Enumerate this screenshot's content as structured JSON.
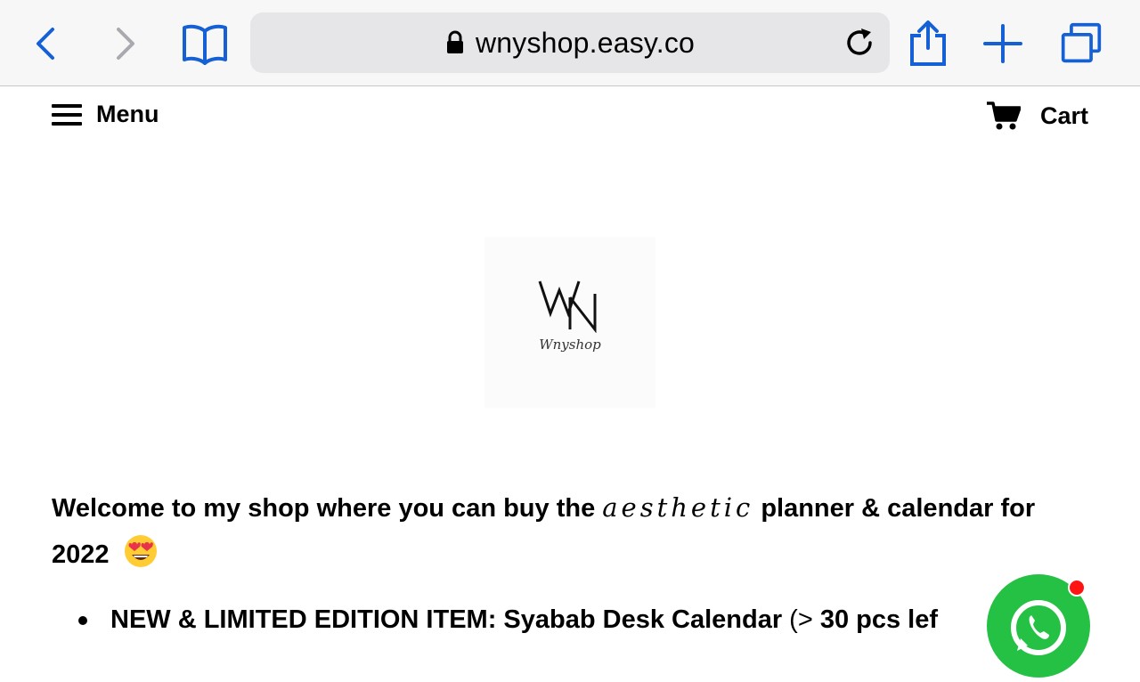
{
  "browser": {
    "url": "wnyshop.easy.co",
    "colors": {
      "accent": "#1560d4",
      "disabled": "#a9a9ae",
      "address_bg": "#e6e6e8"
    }
  },
  "header": {
    "menu_label": "Menu",
    "cart_label": "Cart"
  },
  "logo": {
    "mark_text": "WN",
    "script_text": "Wnyshop"
  },
  "content": {
    "intro_before": "Welcome to my shop where you can buy the ",
    "intro_fancy": "aesthetic",
    "intro_after": " planner & calendar for 2022",
    "bullet_bold": "NEW & LIMITED EDITION ITEM: Syabab Desk Calendar",
    "bullet_paren_open": " (",
    "bullet_gt": "> ",
    "bullet_count": "30 pcs lef"
  },
  "whatsapp": {
    "icon": "whatsapp-icon",
    "color": "#25c144",
    "badge_color": "#ff1414"
  }
}
